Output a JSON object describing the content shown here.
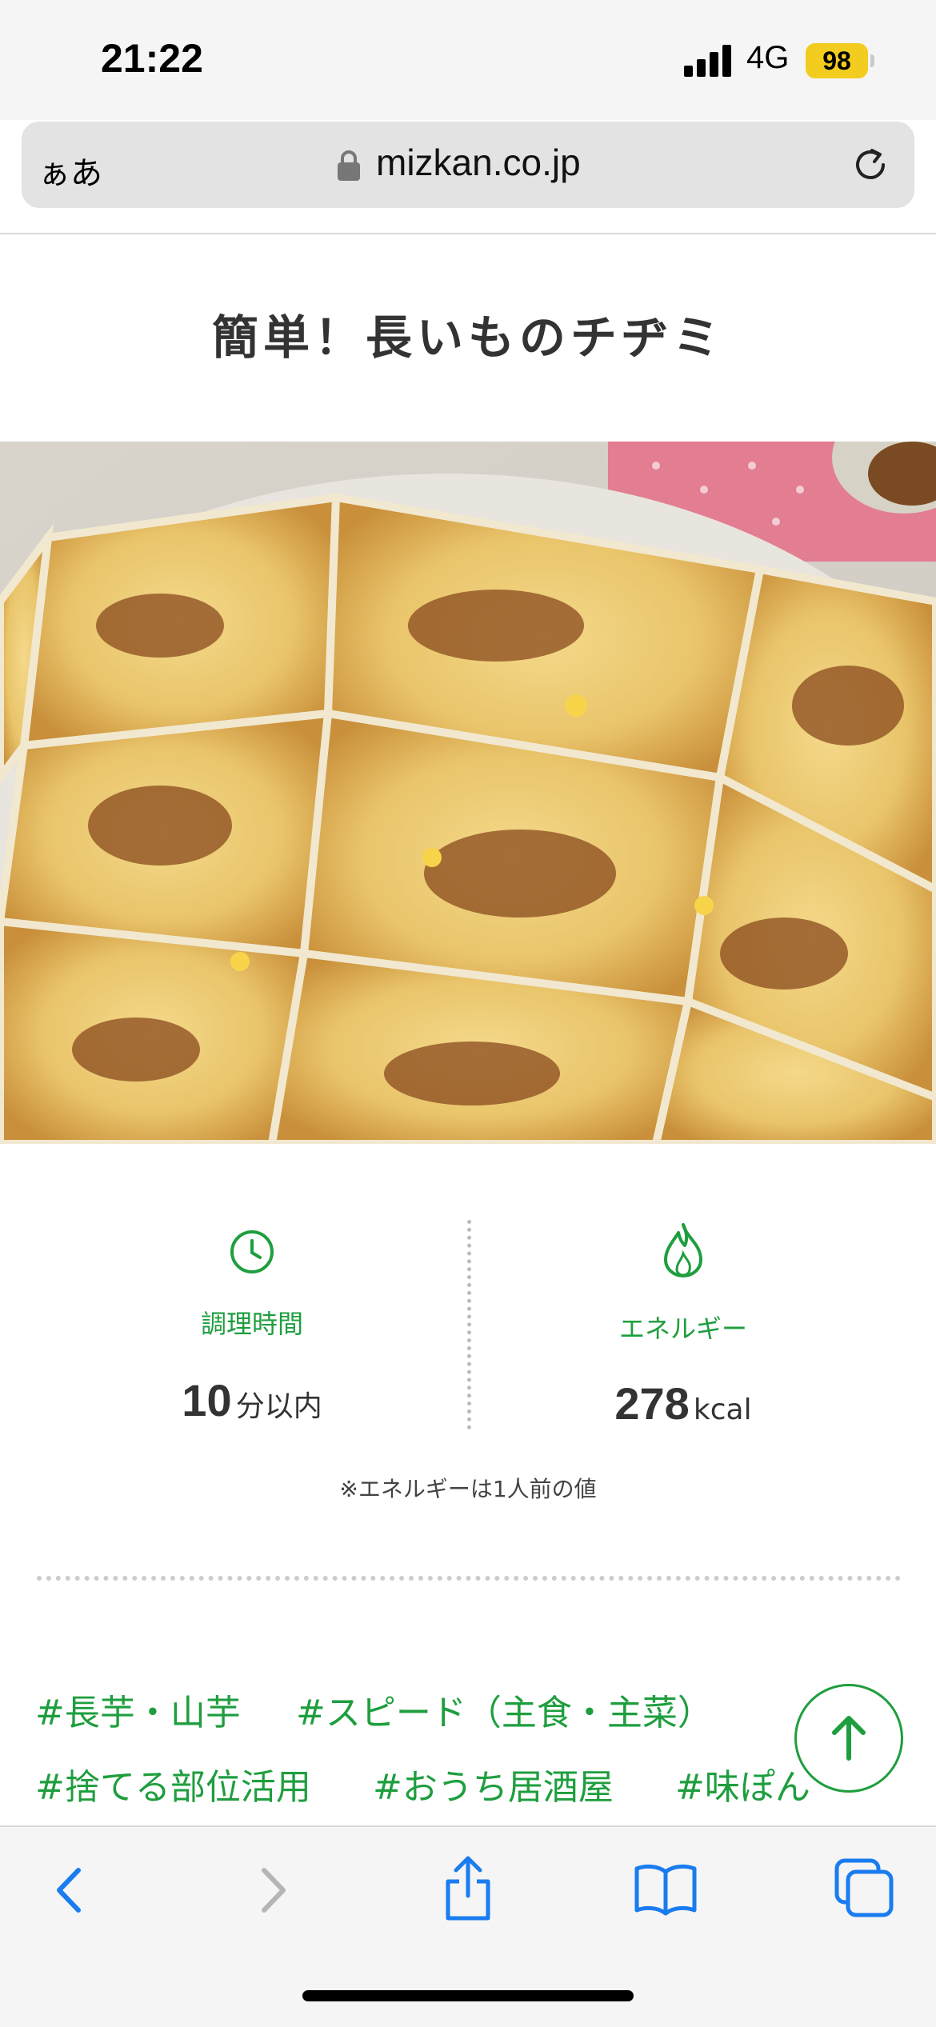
{
  "status_bar": {
    "time": "21:22",
    "network": "4G",
    "battery": "98"
  },
  "browser": {
    "text_size_label": "ぁあ",
    "url": "mizkan.co.jp"
  },
  "recipe": {
    "title": "簡単！長いものチヂミ",
    "cook_time": {
      "label": "調理時間",
      "value": "10",
      "unit": "分以内"
    },
    "energy": {
      "label": "エネルギー",
      "value": "278",
      "unit": "kcal"
    },
    "note": "※エネルギーは1人前の値",
    "tags": [
      "#長芋・山芋",
      "#スピード（主食・主菜）",
      "#捨てる部位活用",
      "#おうち居酒屋",
      "#味ぽん"
    ]
  },
  "colors": {
    "accent": "#1e9e3e",
    "ios_blue": "#1a7cf0",
    "battery": "#f2cc1f"
  },
  "icons": {
    "cook_time": "clock-icon",
    "energy": "flame-icon",
    "scroll_top": "arrow-up-icon",
    "toolbar": [
      "back-icon",
      "forward-icon",
      "share-icon",
      "bookmarks-icon",
      "tabs-icon"
    ]
  }
}
